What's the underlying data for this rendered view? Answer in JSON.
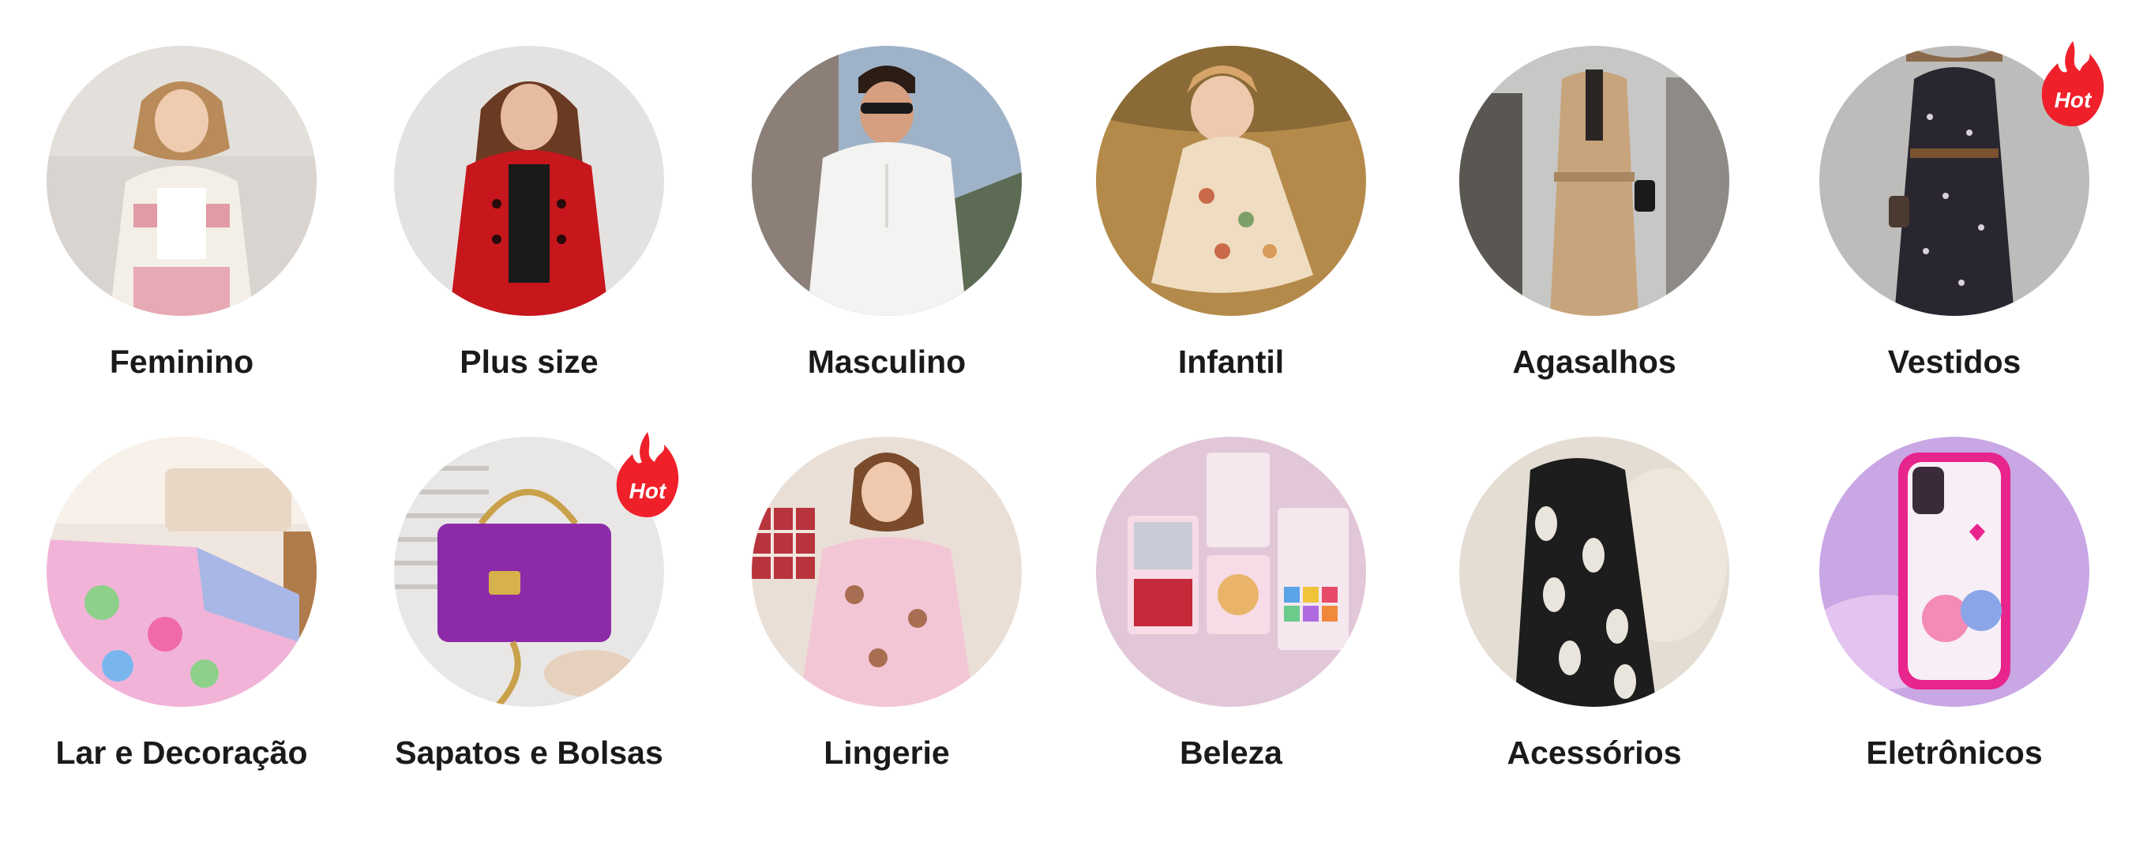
{
  "categories": {
    "row1": [
      {
        "label": "Feminino",
        "icon": "woman-white-jacket-photo",
        "bg": "#d9d4cf",
        "accent": "#f4efe6",
        "hot": false
      },
      {
        "label": "Plus size",
        "icon": "woman-red-coat-photo",
        "bg": "#e4e2e0",
        "accent": "#c8161d",
        "hot": false
      },
      {
        "label": "Masculino",
        "icon": "man-white-shirt-photo",
        "bg": "#9fb3c8",
        "accent": "#f3f3f1",
        "hot": false
      },
      {
        "label": "Infantil",
        "icon": "girl-floral-dress-photo",
        "bg": "#b48a4a",
        "accent": "#f0dcc0",
        "hot": false
      },
      {
        "label": "Agasalhos",
        "icon": "camel-coat-photo",
        "bg": "#c7c7c5",
        "accent": "#c8a47c",
        "hot": false
      },
      {
        "label": "Vestidos",
        "icon": "floral-maxi-dress-photo",
        "bg": "#bdbcba",
        "accent": "#2a2630",
        "hot": true
      }
    ],
    "row2": [
      {
        "label": "Lar e Decoração",
        "icon": "bedding-set-photo",
        "bg": "#efe6df",
        "accent": "#f1b4d8",
        "hot": false
      },
      {
        "label": "Sapatos e Bolsas",
        "icon": "purple-handbag-photo",
        "bg": "#e9e7e6",
        "accent": "#8d2aa8",
        "hot": true
      },
      {
        "label": "Lingerie",
        "icon": "pajama-set-photo",
        "bg": "#eadfd6",
        "accent": "#f3c6d6",
        "hot": false
      },
      {
        "label": "Beleza",
        "icon": "makeup-palette-photo",
        "bg": "#e2c7d8",
        "accent": "#f7dbe6",
        "hot": false
      },
      {
        "label": "Acessórios",
        "icon": "paisley-scarf-photo",
        "bg": "#e4ddd3",
        "accent": "#1d1d1d",
        "hot": false
      },
      {
        "label": "Eletrônicos",
        "icon": "phone-case-photo",
        "bg": "#c9a6e4",
        "accent": "#e8248d",
        "hot": false
      }
    ]
  },
  "hot_badge": {
    "text": "Hot",
    "color": "#f0202a",
    "icon": "flame-icon"
  }
}
